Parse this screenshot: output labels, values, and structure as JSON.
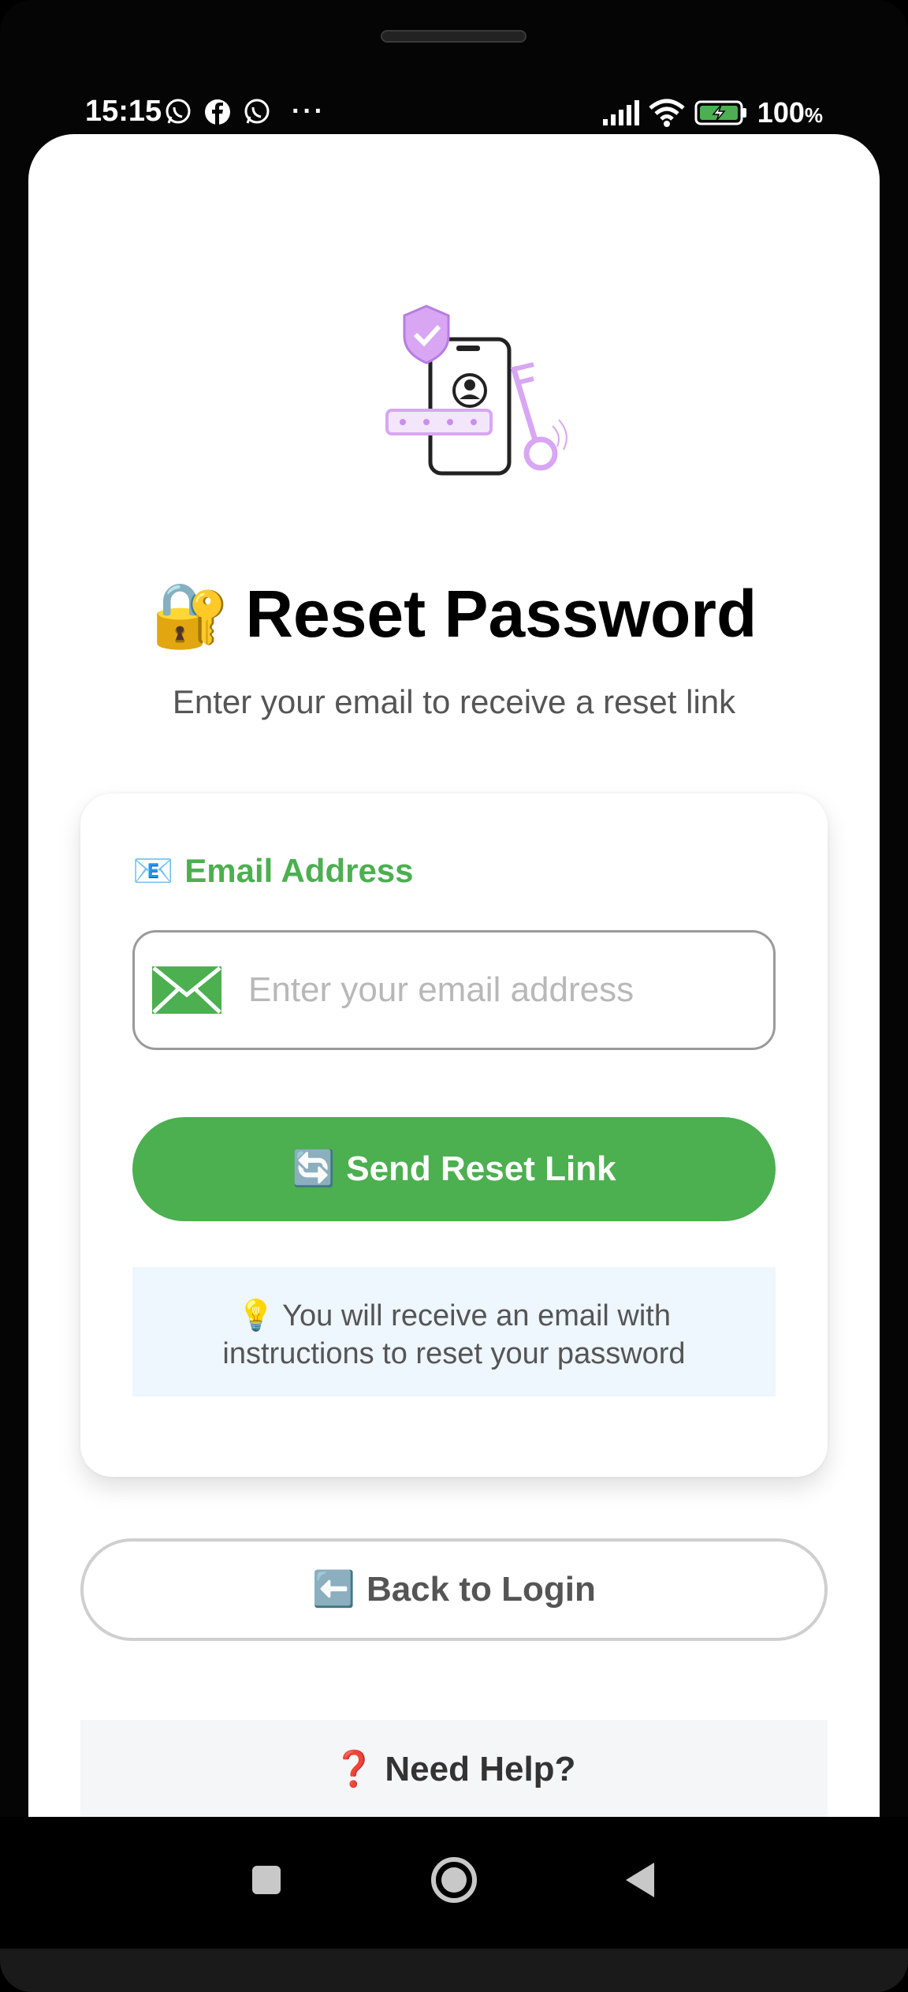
{
  "status_bar": {
    "time": "15:15",
    "notification_icons": [
      "whatsapp-icon",
      "facebook-icon",
      "whatsapp-icon"
    ],
    "more": "···",
    "battery_percent": "100",
    "battery_unit": "%"
  },
  "page": {
    "title_emoji": "🔐",
    "title": "Reset Password",
    "subtitle": "Enter your email to receive a reset link"
  },
  "form": {
    "label_emoji": "📧",
    "label": "Email Address",
    "email_value": "",
    "email_placeholder": "Enter your email address",
    "submit_emoji": "🔄",
    "submit_label": "Send Reset Link",
    "info_emoji": "💡",
    "info_line1": "You will receive an email with",
    "info_line2": "instructions to reset your password"
  },
  "back": {
    "emoji": "⬅️",
    "label": "Back to Login"
  },
  "help": {
    "emoji": "❓",
    "title": "Need Help?"
  },
  "colors": {
    "accent": "#4caf50",
    "info_bg": "#eef6fe",
    "illustration": "#d8a6f3"
  }
}
